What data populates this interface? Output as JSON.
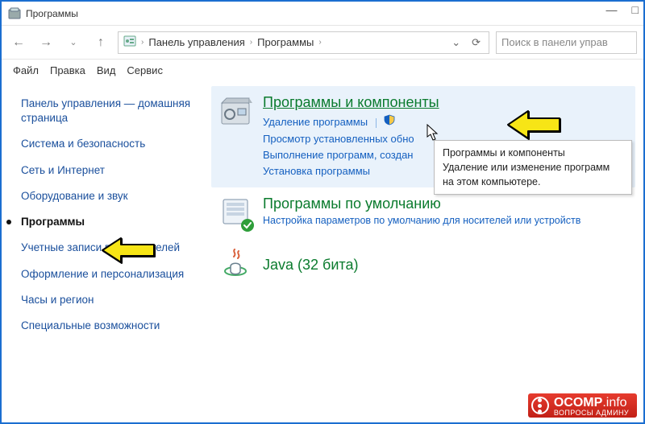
{
  "window": {
    "title": "Программы"
  },
  "winbuttons": {
    "min": "—",
    "max": "□"
  },
  "nav": {
    "back": "←",
    "fwd": "→",
    "up": "↑",
    "dropdown": "⌄",
    "refresh": "⟳"
  },
  "breadcrumb": {
    "c0": "Панель управления",
    "c1": "Программы",
    "sep": "›"
  },
  "search": {
    "placeholder": "Поиск в панели управ"
  },
  "menu": {
    "file": "Файл",
    "edit": "Правка",
    "view": "Вид",
    "service": "Сервис"
  },
  "sidebar": {
    "items": [
      {
        "label": "Панель управления — домашняя страница"
      },
      {
        "label": "Система и безопасность"
      },
      {
        "label": "Сеть и Интернет"
      },
      {
        "label": "Оборудование и звук"
      },
      {
        "label": "Программы"
      },
      {
        "label": "Учетные записи пользователей"
      },
      {
        "label": "Оформление и персонализация"
      },
      {
        "label": "Часы и регион"
      },
      {
        "label": "Специальные возможности"
      }
    ]
  },
  "cats": {
    "progs": {
      "title": "Программы и компоненты",
      "l1": "Удаление программы",
      "l2a": "Просмотр установленных обно",
      "l2b": "Выполнение программ, создан",
      "l3": "Установка программы"
    },
    "defaults": {
      "title": "Программы по умолчанию",
      "sub": "Настройка параметров по умолчанию для носителей или устройств"
    },
    "java": {
      "title": "Java (32 бита)"
    }
  },
  "tooltip": {
    "t1": "Программы и компоненты",
    "t2": "Удаление или изменение программ на этом компьютере."
  },
  "watermark": {
    "brand": "OCOMP",
    "tld": ".info",
    "sub": "ВОПРОСЫ АДМИНУ"
  }
}
